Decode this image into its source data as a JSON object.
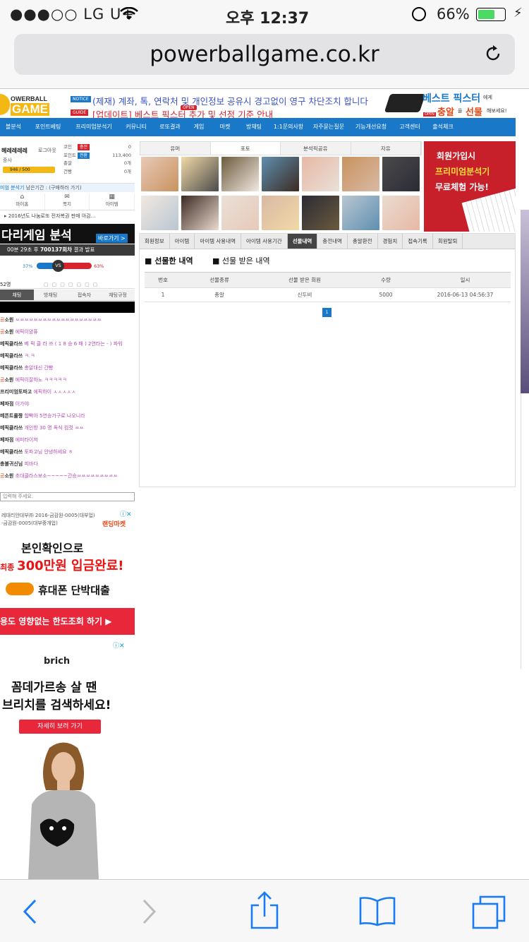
{
  "status": {
    "carrier": "●●●○○ LG U+",
    "time": "오후 12:37",
    "battery": "66%"
  },
  "browser": {
    "url": "powerballgame.co.kr"
  },
  "header": {
    "logo_top": "OWERBALL",
    "logo_bottom": "GAME",
    "notice_tag": "NOTICE",
    "notice_text": "(제재) 계좌, 톡, 연락처 및 개인정보 공유시 경고없이 영구 차단조치 합니다",
    "guide_tag": "GUIDE",
    "guide_text": "[업데이트] 베스트 픽스터 추가 및 선정 기준 안내",
    "open_badge": "OPEN",
    "promo_line1": "베스트 픽스터",
    "promo_suffix1": "에게",
    "promo_line2a": "충알",
    "promo_line2b": "을",
    "promo_line2c": "선물",
    "promo_suffix2": "해보세요!",
    "promo_open": "OPEN"
  },
  "nav": [
    "볼분석",
    "포인트베팅",
    "프리미엄분석기",
    "커뮤니티",
    "로또결과",
    "게임",
    "마켓",
    "방채팅",
    "1:1문의사항",
    "자주묻는질문",
    "기능개선요청",
    "고객센터",
    "출석체크"
  ],
  "nav_open_badge": "OPEN",
  "user": {
    "name": "헤레레레레",
    "logout": "로그아웃",
    "rank": "중사",
    "exp": "946 / 500",
    "rows": [
      {
        "k": "코인",
        "badge": "충전",
        "v": "0"
      },
      {
        "k": "포인트",
        "badge": "전환",
        "v": "113,400"
      },
      {
        "k": "총알",
        "badge": "",
        "v": "0개"
      },
      {
        "k": "건빵",
        "badge": "",
        "v": "0개"
      }
    ],
    "premium": "미엄 분석기",
    "remain": "남은기간 : (구매하러 가기)",
    "icons": [
      "마이홈",
      "쪽지",
      "아이템"
    ],
    "news": "2016년도 나눔로또 전자복권 판매 아감..."
  },
  "ladder": {
    "title": "다리게임 분석",
    "go": "바로가기 >",
    "info_prefix": "00분 29초 후 ",
    "round": "700137회차",
    "info_suffix": " 결과 발표",
    "left_pct": "37%",
    "right_pct": "63%",
    "vs": "VS"
  },
  "chat": {
    "count": "52명",
    "tabs": [
      "채팅",
      "방채팅",
      "접속자",
      "채팅규정"
    ],
    "lines": [
      {
        "r": "공",
        "name": "소원",
        "msg": "ㅆㅆㅆㅆㅆㅆㅆㅆㅆㅆㅆㅆㅆㅆㅆㅆㅆㅆㅆ"
      },
      {
        "r": "공",
        "name": "소원",
        "msg": "에픽이얌퓨"
      },
      {
        "r": "",
        "name": "메픽클라쓰",
        "msg": "베 픽 클 라 쓰 ( 1 8 승 6 패 ) 2연타는 - ) 파워"
      },
      {
        "r": "",
        "name": "",
        "msg": ""
      },
      {
        "r": "",
        "name": "메픽클라쓰",
        "msg": "ㅋ.ㅋ"
      },
      {
        "r": "",
        "name": "메픽클라쓰",
        "msg": "총알대신 간빵"
      },
      {
        "r": "공",
        "name": "소원",
        "msg": "에픽이잘하노 ㅋㅋㅋㅋㅋ"
      },
      {
        "r": "",
        "name": "프리미엄토파고",
        "msg": "에픽하이 ㅅㅅㅅㅅㅅ"
      },
      {
        "r": "",
        "name": "페파점",
        "msg": "이가야"
      },
      {
        "r": "",
        "name": "메픈트롤짱",
        "msg": "합빡아 5연승가구로 나오니라"
      },
      {
        "r": "",
        "name": "메픽클라쓰",
        "msg": "개인방 30 명 독식 컴컷 ㅆㅆ"
      },
      {
        "r": "",
        "name": "페파점",
        "msg": "에피타이저"
      },
      {
        "r": "",
        "name": "메픽클라쓰",
        "msg": "토파고님 안녕하세요 ㅎ"
      },
      {
        "r": "",
        "name": "총불귀신님",
        "msg": "피바다"
      },
      {
        "r": "공",
        "name": "소원",
        "msg": "초대클라스보소~~~~~간승ㅆㅆㅆㅆㅆㅆㅆㅆㅆ"
      }
    ],
    "placeholder": "입력해 주세요."
  },
  "ad1": {
    "l1": "레대리안대부㈜ 2016-금감원-0005(대부업)",
    "l2": "-금감원-0005(대부중개업)",
    "brand": "랜딩마켓",
    "main1": "본인확인으로",
    "main2a": "최종 ",
    "main2b": "300만원 입금완료!",
    "p1": "휴대폰 단박대출",
    "bottom": "용도 영향없는 한도조회 하기 ▶"
  },
  "ad2": {
    "brand": "brich",
    "head1": "꼼데가르송 살 땐",
    "head2": "브리치를 검색하세요!",
    "btn": "자세히 보러 가기"
  },
  "board": {
    "tabs": [
      "유머",
      "포토",
      "분석픽공유",
      "자유"
    ],
    "active": 1
  },
  "banner": {
    "l1": "회원가입시",
    "l2": "프리미엄분석기",
    "l3": "무료체험 가능!"
  },
  "subtabs": [
    "회원정보",
    "아이템",
    "아이템 사용내역",
    "아이템 사용기간",
    "선물내역",
    "충전내역",
    "총알환전",
    "경험치",
    "접속기록",
    "회원탈퇴"
  ],
  "subtab_active": 4,
  "gift": {
    "sent_title": "■ 선물한 내역",
    "recv_title": "■ 선물 받은 내역",
    "headers": [
      "번호",
      "선물종류",
      "선물 받은 회원",
      "수량",
      "일시"
    ],
    "rows": [
      [
        "1",
        "총알",
        "신두비",
        "5000",
        "2016-06-13 04:56:37"
      ]
    ],
    "page": "1"
  }
}
